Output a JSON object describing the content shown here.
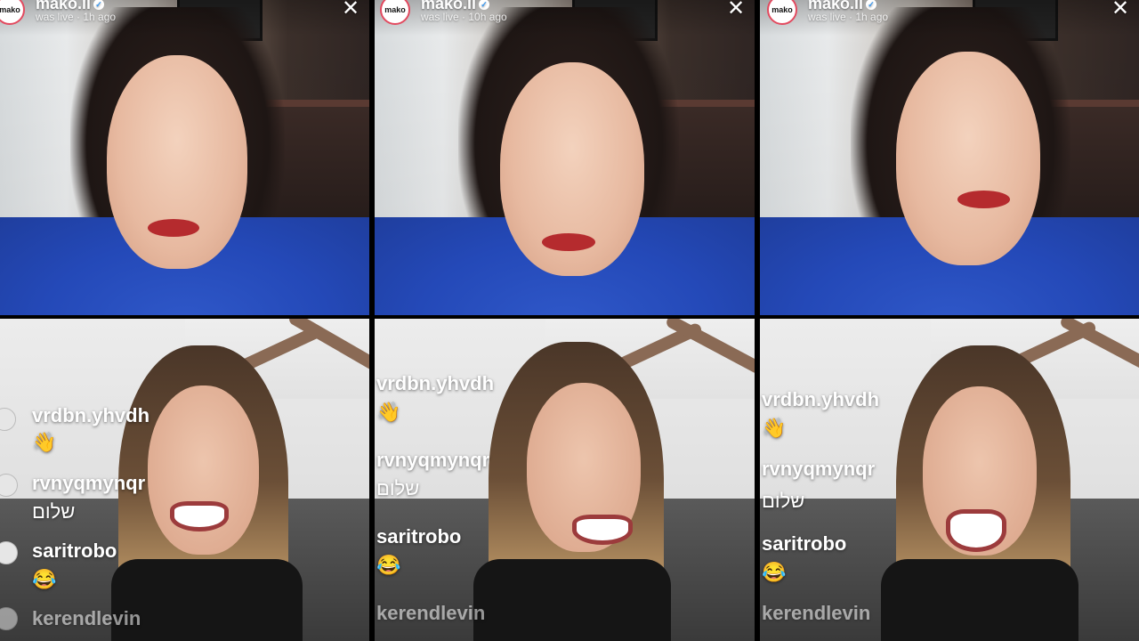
{
  "host": {
    "avatar_text": "mako",
    "name": "mako.il",
    "statuses": [
      "was live · 1h ago",
      "was live · 10h ago",
      "was live · 1h ago"
    ]
  },
  "comments": [
    {
      "user": "vrdbn.yhvdh",
      "text": "👋"
    },
    {
      "user": "rvnyqmynqr",
      "text": "שלום"
    },
    {
      "user": "saritrobo",
      "text": "😂"
    },
    {
      "user": "kerendlevin",
      "text": ""
    }
  ],
  "icons": {
    "close": "close-icon",
    "verified": "verified-badge-icon"
  },
  "colors": {
    "shirt": "#2449b8",
    "lips": "#b52b2e",
    "avatar_ring": "#e24a5f"
  }
}
